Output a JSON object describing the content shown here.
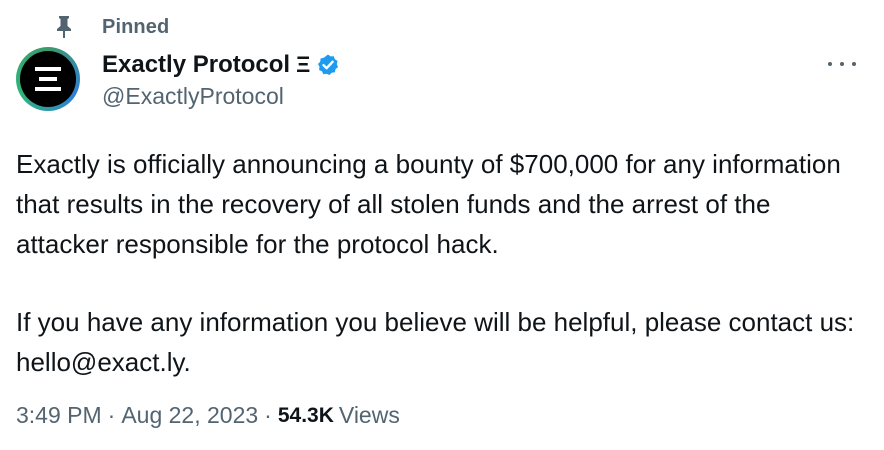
{
  "pinned": {
    "icon": "pin-icon",
    "label": "Pinned"
  },
  "author": {
    "avatar_icon": "exactly-logo-icon",
    "avatar_glyph": "Ξ",
    "display_name": "Exactly Protocol",
    "name_glyph": "Ξ",
    "verified_icon": "verified-badge-icon",
    "verified_color": "#1d9bf0",
    "handle": "@ExactlyProtocol"
  },
  "more_menu": {
    "icon": "more-horizontal-icon"
  },
  "tweet": {
    "paragraphs": [
      "Exactly is officially announcing a bounty of $700,000 for any information that results in the recovery of all stolen funds and the arrest of the attacker responsible for the protocol hack.",
      "If you have any information you believe will be helpful, please contact us: hello@exact.ly."
    ]
  },
  "meta": {
    "time": "3:49 PM",
    "separator": "·",
    "date": "Aug 22, 2023",
    "views_count": "54.3K",
    "views_label": "Views"
  },
  "colors": {
    "text_primary": "#0f1419",
    "text_secondary": "#536471",
    "verified_blue": "#1d9bf0"
  }
}
